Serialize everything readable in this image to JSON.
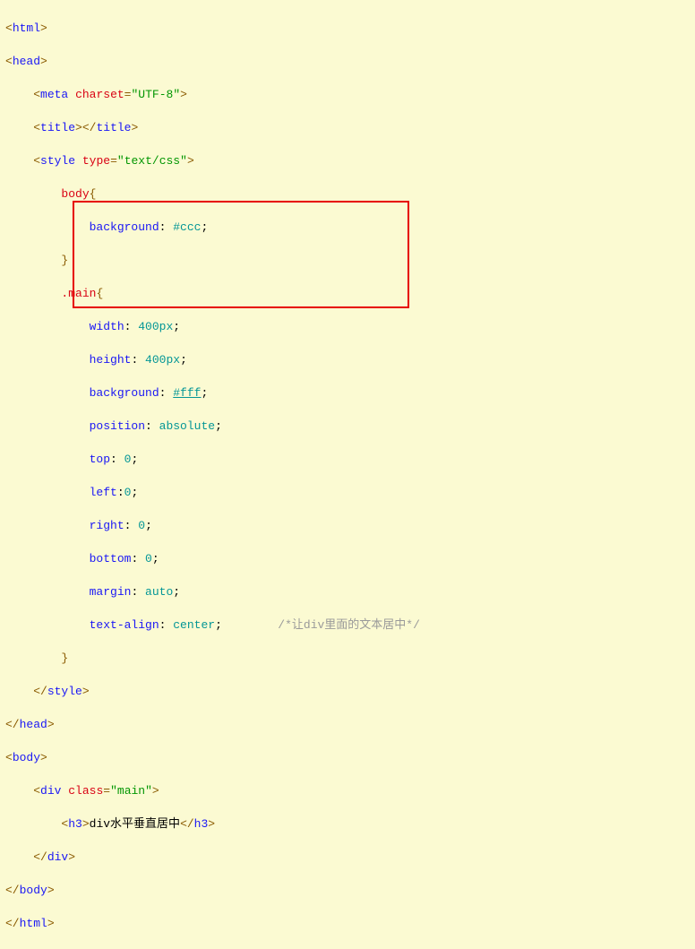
{
  "l1": {
    "open": "<",
    "tag": "html",
    "close": ">"
  },
  "l2": {
    "open": "<",
    "tag": "head",
    "close": ">"
  },
  "l3": {
    "open": "<",
    "tag": "meta",
    "sp": " ",
    "attr": "charset",
    "eq": "=",
    "q1": "\"",
    "val": "UTF-8",
    "q2": "\"",
    "close": ">"
  },
  "l4": {
    "open": "<",
    "tag": "title",
    "close1": ">",
    "open2": "</",
    "tag2": "title",
    "close2": ">"
  },
  "l5": {
    "open": "<",
    "tag": "style",
    "sp": " ",
    "attr": "type",
    "eq": "=",
    "q1": "\"",
    "val": "text/css",
    "q2": "\"",
    "close": ">"
  },
  "l6": {
    "sel": "body",
    "br": "{"
  },
  "l7": {
    "prop": "background",
    "colon": ": ",
    "val": "#ccc",
    "semi": ";"
  },
  "l8": {
    "br": "}"
  },
  "l9": {
    "dot": ".",
    "sel": "main",
    "br": "{"
  },
  "l10": {
    "prop": "width",
    "colon": ": ",
    "val": "400px",
    "semi": ";"
  },
  "l11": {
    "prop": "height",
    "colon": ": ",
    "val": "400px",
    "semi": ";"
  },
  "l12": {
    "prop": "background",
    "colon": ": ",
    "val": "#fff",
    "semi": ";"
  },
  "l13": {
    "prop": "position",
    "colon": ": ",
    "val": "absolute",
    "semi": ";"
  },
  "l14": {
    "prop": "top",
    "colon": ": ",
    "val": "0",
    "semi": ";"
  },
  "l15": {
    "prop": "left",
    "colon": ":",
    "val": "0",
    "semi": ";"
  },
  "l16": {
    "prop": "right",
    "colon": ": ",
    "val": "0",
    "semi": ";"
  },
  "l17": {
    "prop": "bottom",
    "colon": ": ",
    "val": "0",
    "semi": ";"
  },
  "l18": {
    "prop": "margin",
    "colon": ": ",
    "val": "auto",
    "semi": ";"
  },
  "l19": {
    "prop": "text-align",
    "colon": ": ",
    "val": "center",
    "semi": ";",
    "comment": "/*让div里面的文本居中*/"
  },
  "l20": {
    "br": "}"
  },
  "l21": {
    "open": "</",
    "tag": "style",
    "close": ">"
  },
  "l22": {
    "open": "</",
    "tag": "head",
    "close": ">"
  },
  "l23": {
    "open": "<",
    "tag": "body",
    "close": ">"
  },
  "l24": {
    "open": "<",
    "tag": "div",
    "sp": " ",
    "attr": "class",
    "eq": "=",
    "q1": "\"",
    "val": "main",
    "q2": "\"",
    "close": ">"
  },
  "l25": {
    "open": "<",
    "tag": "h3",
    "close1": ">",
    "text": "div水平垂直居中",
    "open2": "</",
    "tag2": "h3",
    "close2": ">"
  },
  "l26": {
    "open": "</",
    "tag": "div",
    "close": ">"
  },
  "l27": {
    "open": "</",
    "tag": "body",
    "close": ">"
  },
  "l28": {
    "open": "</",
    "tag": "html",
    "close": ">"
  }
}
